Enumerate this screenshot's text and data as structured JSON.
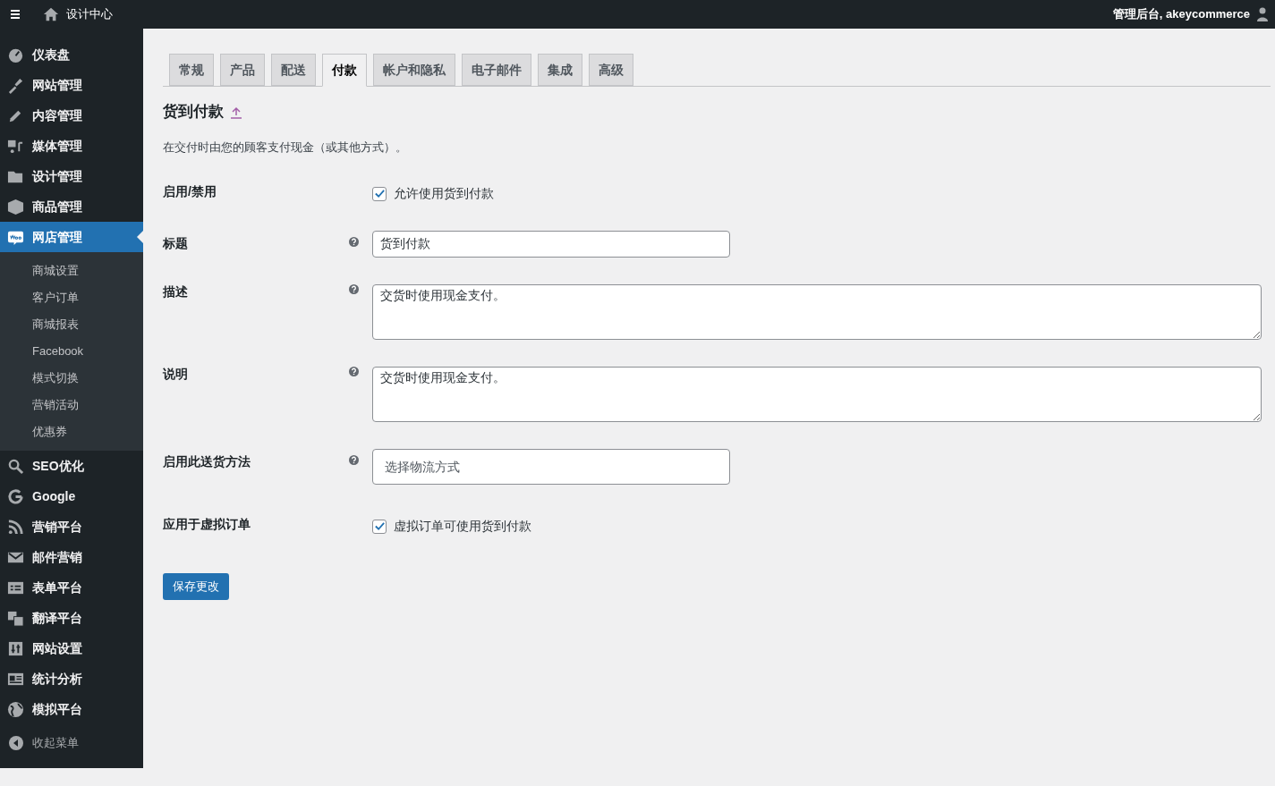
{
  "top_bar": {
    "site_title": "设计中心",
    "account": "管理后台, akeycommerce"
  },
  "sidebar": {
    "items": [
      {
        "label": "仪表盘",
        "selected": false
      },
      {
        "label": "网站管理",
        "selected": false
      },
      {
        "label": "内容管理",
        "selected": false
      },
      {
        "label": "媒体管理",
        "selected": false
      },
      {
        "label": "设计管理",
        "selected": false
      },
      {
        "label": "商品管理",
        "selected": false
      },
      {
        "label": "网店管理",
        "selected": true,
        "children": [
          {
            "label": "商城设置"
          },
          {
            "label": "客户订单"
          },
          {
            "label": "商城报表"
          },
          {
            "label": "Facebook"
          },
          {
            "label": "模式切换"
          },
          {
            "label": "营销活动"
          },
          {
            "label": "优惠券"
          }
        ]
      },
      {
        "label": "SEO优化",
        "selected": false
      },
      {
        "label": "Google",
        "selected": false
      },
      {
        "label": "营销平台",
        "selected": false
      },
      {
        "label": "邮件营销",
        "selected": false
      },
      {
        "label": "表单平台",
        "selected": false
      },
      {
        "label": "翻译平台",
        "selected": false
      },
      {
        "label": "网站设置",
        "selected": false
      },
      {
        "label": "统计分析",
        "selected": false
      },
      {
        "label": "模拟平台",
        "selected": false
      }
    ],
    "collapse": "收起菜单"
  },
  "tabs": [
    {
      "label": "常规",
      "selected": false
    },
    {
      "label": "产品",
      "selected": false
    },
    {
      "label": "配送",
      "selected": false
    },
    {
      "label": "付款",
      "selected": true
    },
    {
      "label": "帐户和隐私",
      "selected": false
    },
    {
      "label": "电子邮件",
      "selected": false
    },
    {
      "label": "集成",
      "selected": false
    },
    {
      "label": "高级",
      "selected": false
    }
  ],
  "section": {
    "title": "货到付款",
    "description": "在交付时由您的顾客支付现金（或其他方式）。"
  },
  "fields": [
    {
      "kind": "checkbox",
      "label": "启用/禁用",
      "help": false,
      "text": "允许使用货到付款",
      "checked": true
    },
    {
      "kind": "text",
      "label": "标题",
      "help": true,
      "value": "货到付款"
    },
    {
      "kind": "textarea",
      "label": "描述",
      "help": true,
      "value": "交货时使用现金支付。"
    },
    {
      "kind": "textarea",
      "label": "说明",
      "help": true,
      "value": "交货时使用现金支付。"
    },
    {
      "kind": "select",
      "label": "启用此送货方法",
      "help": true,
      "placeholder": "选择物流方式"
    },
    {
      "kind": "checkbox",
      "label": "应用于虚拟订单",
      "help": false,
      "text": "虚拟订单可使用货到付款",
      "checked": true
    }
  ],
  "save_button": "保存更改"
}
